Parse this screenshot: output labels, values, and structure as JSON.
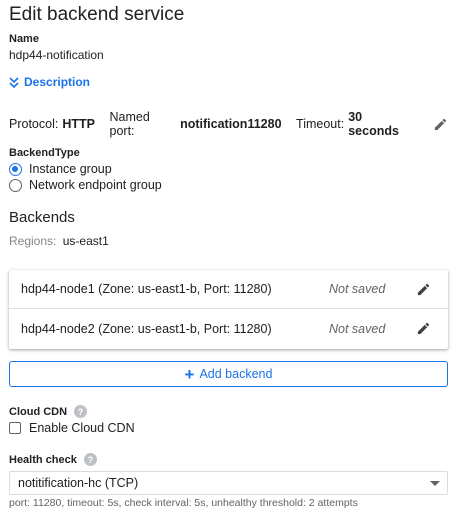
{
  "title": "Edit backend service",
  "name": {
    "label": "Name",
    "value": "hdp44-notification"
  },
  "description_toggle": {
    "label": "Description"
  },
  "protocol": {
    "protocol_label": "Protocol:",
    "protocol_value": "HTTP",
    "named_port_label": "Named port:",
    "named_port_value": "notification11280",
    "timeout_label": "Timeout:",
    "timeout_value": "30 seconds"
  },
  "backend_type": {
    "label": "BackendType",
    "options": [
      {
        "label": "Instance group",
        "selected": true
      },
      {
        "label": "Network endpoint group",
        "selected": false
      }
    ]
  },
  "backends": {
    "title": "Backends",
    "regions_label": "Regions:",
    "regions_value": "us-east1",
    "rows": [
      {
        "name": "hdp44-node1 (Zone: us-east1-b, Port: 11280)",
        "status": "Not saved"
      },
      {
        "name": "hdp44-node2 (Zone: us-east1-b, Port: 11280)",
        "status": "Not saved"
      }
    ],
    "add_label": "Add backend"
  },
  "cdn": {
    "label": "Cloud CDN",
    "checkbox_label": "Enable Cloud CDN",
    "checked": false
  },
  "health_check": {
    "label": "Health check",
    "selected": "notitification-hc (TCP)",
    "detail": "port: 11280, timeout: 5s, check interval: 5s, unhealthy threshold: 2 attempts"
  },
  "colors": {
    "accent": "#1a73e8",
    "text": "#202124",
    "muted": "#5f6368"
  },
  "icons": {
    "edit": "pencil-icon",
    "chevron": "chevron-down-double-icon",
    "help": "help-circle-icon",
    "dropdown": "dropdown-arrow-icon",
    "add": "plus-icon"
  }
}
